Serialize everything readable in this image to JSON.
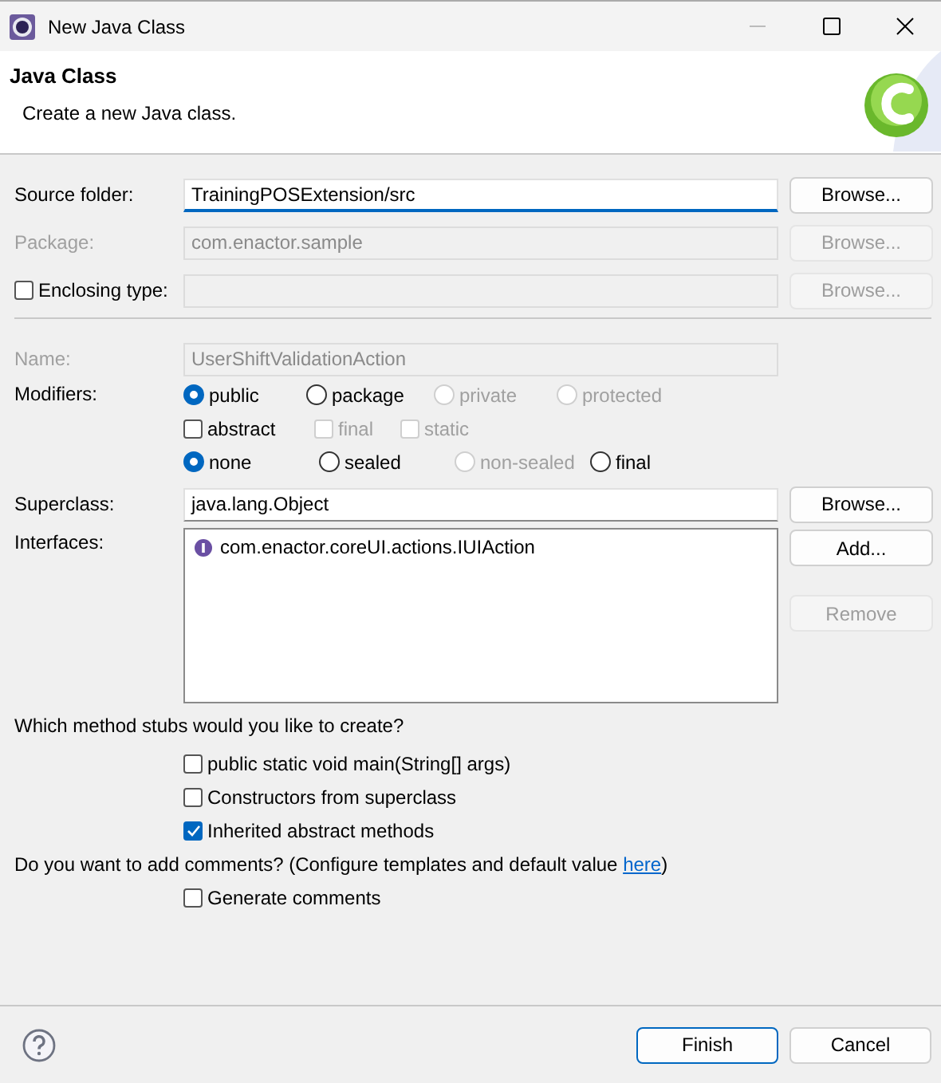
{
  "window": {
    "title": "New Java Class"
  },
  "header": {
    "title": "Java Class",
    "description": "Create a new Java class."
  },
  "location_rows": [
    {
      "kind": "text",
      "label": "Source folder:",
      "value": "TrainingPOSExtension/src",
      "disabled": false,
      "focused": true,
      "button": {
        "label": "Browse...",
        "disabled": false
      }
    },
    {
      "kind": "text",
      "label": "Package:",
      "value": "com.enactor.sample",
      "disabled": true,
      "focused": false,
      "button": {
        "label": "Browse...",
        "disabled": true
      }
    },
    {
      "kind": "checkbox",
      "label": "Enclosing type:",
      "checked": false,
      "value": "",
      "disabled": true,
      "focused": false,
      "button": {
        "label": "Browse...",
        "disabled": true
      }
    }
  ],
  "name_row": {
    "label": "Name:",
    "value": "UserShiftValidationAction",
    "disabled": true
  },
  "modifiers": {
    "label": "Modifiers:",
    "rows": [
      {
        "options": [
          {
            "kind": "radio",
            "label": "public",
            "selected": true,
            "disabled": false
          },
          {
            "kind": "radio",
            "label": "package",
            "selected": false,
            "disabled": false
          },
          {
            "kind": "radio",
            "label": "private",
            "selected": false,
            "disabled": true
          },
          {
            "kind": "radio",
            "label": "protected",
            "selected": false,
            "disabled": true
          }
        ]
      },
      {
        "options": [
          {
            "kind": "checkbox",
            "label": "abstract",
            "checked": false,
            "disabled": false
          },
          {
            "kind": "checkbox",
            "label": "final",
            "checked": false,
            "disabled": true
          },
          {
            "kind": "checkbox",
            "label": "static",
            "checked": false,
            "disabled": true
          }
        ]
      },
      {
        "options": [
          {
            "kind": "radio",
            "label": "none",
            "selected": true,
            "disabled": false
          },
          {
            "kind": "radio",
            "label": "sealed",
            "selected": false,
            "disabled": false
          },
          {
            "kind": "radio",
            "label": "non-sealed",
            "selected": false,
            "disabled": true
          },
          {
            "kind": "radio",
            "label": "final",
            "selected": false,
            "disabled": false
          }
        ]
      }
    ]
  },
  "superclass": {
    "label": "Superclass:",
    "value": "java.lang.Object",
    "button": {
      "label": "Browse...",
      "disabled": false
    }
  },
  "interfaces": {
    "label": "Interfaces:",
    "items": [
      "com.enactor.coreUI.actions.IUIAction"
    ],
    "buttons": [
      {
        "label": "Add...",
        "disabled": false
      },
      {
        "label": "Remove",
        "disabled": true
      }
    ]
  },
  "stubs": {
    "question": "Which method stubs would you like to create?",
    "options": [
      {
        "label": "public static void main(String[] args)",
        "checked": false
      },
      {
        "label": "Constructors from superclass",
        "checked": false
      },
      {
        "label": "Inherited abstract methods",
        "checked": true
      }
    ]
  },
  "comments": {
    "prompt": "Do you want to add comments? (Configure templates and default value ",
    "link": "here",
    "prompt_end": ")",
    "options": [
      {
        "label": "Generate comments",
        "checked": false
      }
    ]
  },
  "footer": {
    "buttons": [
      {
        "label": "Finish",
        "default": true
      },
      {
        "label": "Cancel",
        "default": false
      }
    ]
  }
}
